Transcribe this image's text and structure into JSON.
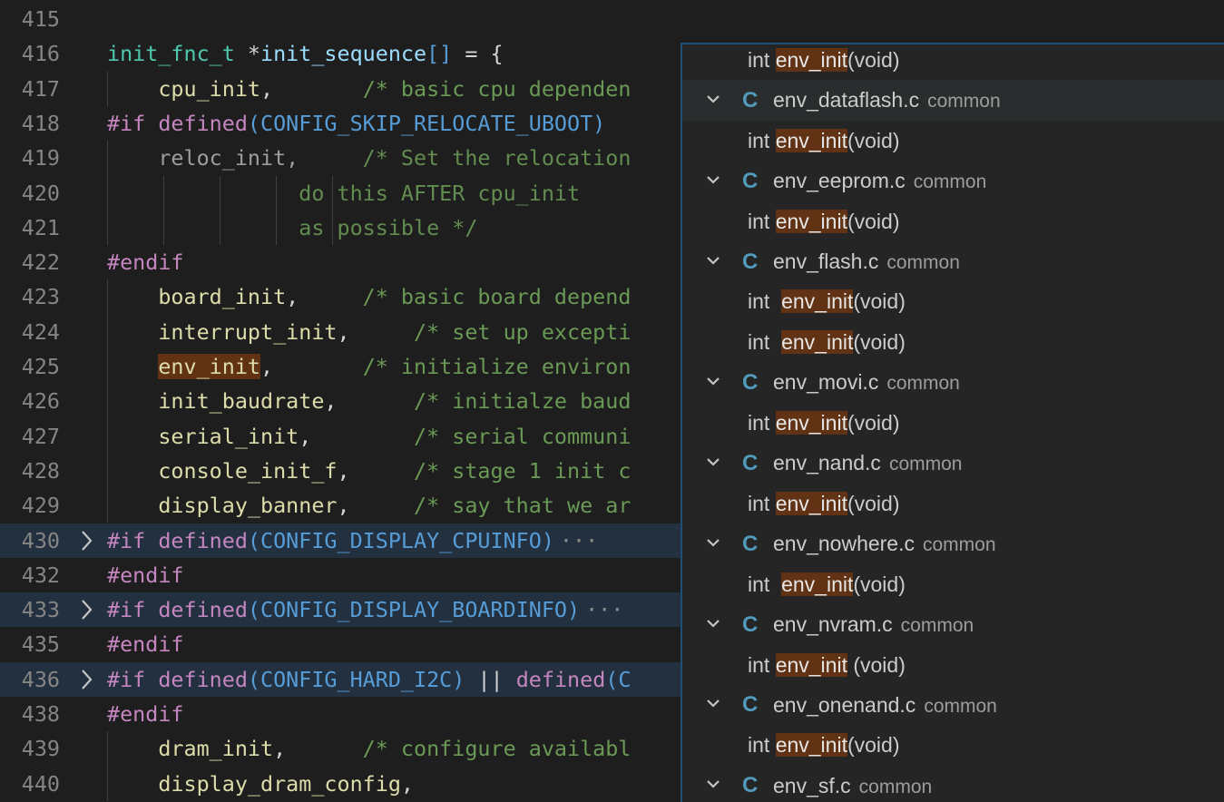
{
  "editor": {
    "lines": [
      {
        "num": "415",
        "kind": "blank"
      },
      {
        "num": "416",
        "kind": "decl",
        "type": "init_fnc_t",
        "star": " *",
        "name": "init_sequence",
        "rest": " = {"
      },
      {
        "num": "417",
        "kind": "entry",
        "fn": "cpu_init",
        "sep": ",       ",
        "comment": "/* basic cpu dependen"
      },
      {
        "num": "418",
        "kind": "if",
        "directive": "#if",
        "defined": "defined",
        "macro": "CONFIG_SKIP_RELOCATE_UBOOT"
      },
      {
        "num": "419",
        "kind": "dimentry",
        "fn": "reloc_init",
        "sep": ",     ",
        "comment": "/* Set the relocation"
      },
      {
        "num": "420",
        "kind": "dimcont",
        "comment": "do this AFTER cpu_init"
      },
      {
        "num": "421",
        "kind": "dimcont",
        "comment": "as possible */"
      },
      {
        "num": "422",
        "kind": "endif",
        "directive": "#endif"
      },
      {
        "num": "423",
        "kind": "entry",
        "fn": "board_init",
        "sep": ",     ",
        "comment": "/* basic board depend"
      },
      {
        "num": "424",
        "kind": "entry",
        "fn": "interrupt_init",
        "sep": ",     ",
        "comment": "/* set up excepti"
      },
      {
        "num": "425",
        "kind": "entry",
        "fn": "env_init",
        "sep": ",       ",
        "comment": "/* initialize environ",
        "highlight": true
      },
      {
        "num": "426",
        "kind": "entry",
        "fn": "init_baudrate",
        "sep": ",      ",
        "comment": "/* initialze baud"
      },
      {
        "num": "427",
        "kind": "entry",
        "fn": "serial_init",
        "sep": ",        ",
        "comment": "/* serial communi"
      },
      {
        "num": "428",
        "kind": "entry",
        "fn": "console_init_f",
        "sep": ",     ",
        "comment": "/* stage 1 init c"
      },
      {
        "num": "429",
        "kind": "entry",
        "fn": "display_banner",
        "sep": ",     ",
        "comment": "/* say that we ar"
      },
      {
        "num": "430",
        "kind": "foldedif",
        "directive": "#if",
        "defined": "defined",
        "macro": "CONFIG_DISPLAY_CPUINFO",
        "ellipsis": "···"
      },
      {
        "num": "432",
        "kind": "endif",
        "directive": "#endif"
      },
      {
        "num": "433",
        "kind": "foldedif",
        "directive": "#if",
        "defined": "defined",
        "macro": "CONFIG_DISPLAY_BOARDINFO",
        "ellipsis": "···"
      },
      {
        "num": "435",
        "kind": "endif",
        "directive": "#endif"
      },
      {
        "num": "436",
        "kind": "foldedor",
        "directive": "#if",
        "defined": "defined",
        "macro": "CONFIG_HARD_I2C",
        "op": " || ",
        "defined2": "defined",
        "macro2": "C"
      },
      {
        "num": "438",
        "kind": "endif",
        "directive": "#endif"
      },
      {
        "num": "439",
        "kind": "entry",
        "fn": "dram_init",
        "sep": ",      ",
        "comment": "/* configure availabl"
      },
      {
        "num": "440",
        "kind": "entry",
        "fn": "display_dram_config",
        "sep": ",",
        "comment": ""
      }
    ]
  },
  "references": {
    "rows": [
      {
        "kind": "match",
        "pre": "int ",
        "hit": "env_init",
        "post": "(void)"
      },
      {
        "kind": "file",
        "icon": "C",
        "file": "env_dataflash.c",
        "dir": "common",
        "selected": true
      },
      {
        "kind": "match",
        "pre": "int ",
        "hit": "env_init",
        "post": "(void)"
      },
      {
        "kind": "file",
        "icon": "C",
        "file": "env_eeprom.c",
        "dir": "common"
      },
      {
        "kind": "match",
        "pre": "int ",
        "hit": "env_init",
        "post": "(void)"
      },
      {
        "kind": "file",
        "icon": "C",
        "file": "env_flash.c",
        "dir": "common"
      },
      {
        "kind": "match",
        "pre": "int  ",
        "hit": "env_init",
        "post": "(void)"
      },
      {
        "kind": "match",
        "pre": "int  ",
        "hit": "env_init",
        "post": "(void)"
      },
      {
        "kind": "file",
        "icon": "C",
        "file": "env_movi.c",
        "dir": "common"
      },
      {
        "kind": "match",
        "pre": "int ",
        "hit": "env_init",
        "post": "(void)"
      },
      {
        "kind": "file",
        "icon": "C",
        "file": "env_nand.c",
        "dir": "common"
      },
      {
        "kind": "match",
        "pre": "int ",
        "hit": "env_init",
        "post": "(void)"
      },
      {
        "kind": "file",
        "icon": "C",
        "file": "env_nowhere.c",
        "dir": "common"
      },
      {
        "kind": "match",
        "pre": "int  ",
        "hit": "env_init",
        "post": "(void)"
      },
      {
        "kind": "file",
        "icon": "C",
        "file": "env_nvram.c",
        "dir": "common"
      },
      {
        "kind": "match",
        "pre": "int ",
        "hit": "env_init",
        "post": " (void)"
      },
      {
        "kind": "file",
        "icon": "C",
        "file": "env_onenand.c",
        "dir": "common"
      },
      {
        "kind": "match",
        "pre": "int ",
        "hit": "env_init",
        "post": "(void)"
      },
      {
        "kind": "file",
        "icon": "C",
        "file": "env_sf.c",
        "dir": "common"
      }
    ]
  },
  "colors": {
    "background": "#1e1e1e",
    "panel": "#252526",
    "match_highlight": "#613214",
    "c_icon": "#519aba"
  }
}
